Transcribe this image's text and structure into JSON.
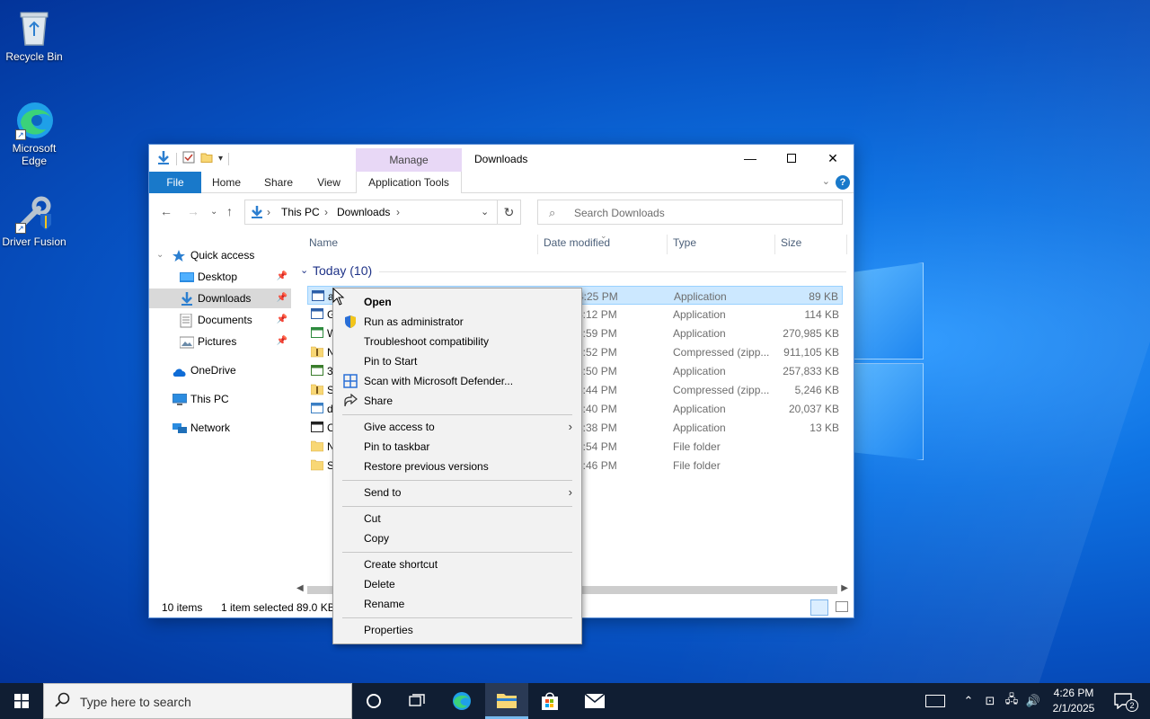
{
  "desktop": {
    "icons": [
      {
        "label": "Recycle Bin"
      },
      {
        "label": "Microsoft Edge"
      },
      {
        "label": "Driver Fusion"
      }
    ]
  },
  "explorer": {
    "title": "Downloads",
    "manage_tab": "Manage",
    "ribbon_tabs": {
      "file": "File",
      "home": "Home",
      "share": "Share",
      "view": "View",
      "app_tools": "Application Tools"
    },
    "address": {
      "this_pc": "This PC",
      "downloads": "Downloads"
    },
    "search_placeholder": "Search Downloads",
    "nav": {
      "quick_access": "Quick access",
      "desktop": "Desktop",
      "downloads": "Downloads",
      "documents": "Documents",
      "pictures": "Pictures",
      "onedrive": "OneDrive",
      "this_pc": "This PC",
      "network": "Network"
    },
    "columns": {
      "name": "Name",
      "date": "Date modified",
      "type": "Type",
      "size": "Size"
    },
    "group": "Today (10)",
    "files": [
      {
        "name": "a",
        "date": "4:25 PM",
        "type": "Application",
        "size": "89 KB"
      },
      {
        "name": "G",
        "date": "4:12 PM",
        "type": "Application",
        "size": "114 KB"
      },
      {
        "name": "W",
        "date": "3:59 PM",
        "type": "Application",
        "size": "270,985 KB"
      },
      {
        "name": "N",
        "date": "3:52 PM",
        "type": "Compressed (zipp...",
        "size": "911,105 KB"
      },
      {
        "name": "3",
        "date": "3:50 PM",
        "type": "Application",
        "size": "257,833 KB"
      },
      {
        "name": "S",
        "date": "3:44 PM",
        "type": "Compressed (zipp...",
        "size": "5,246 KB"
      },
      {
        "name": "d",
        "date": "3:40 PM",
        "type": "Application",
        "size": "20,037 KB"
      },
      {
        "name": "C",
        "date": "3:38 PM",
        "type": "Application",
        "size": "13 KB"
      },
      {
        "name": "N",
        "date": "3:54 PM",
        "type": "File folder",
        "size": ""
      },
      {
        "name": "S",
        "date": "3:46 PM",
        "type": "File folder",
        "size": ""
      }
    ],
    "status": {
      "items": "10 items",
      "selected": "1 item selected",
      "size": "89.0 KB"
    }
  },
  "context_menu": {
    "open": "Open",
    "run_admin": "Run as administrator",
    "troubleshoot": "Troubleshoot compatibility",
    "pin_start": "Pin to Start",
    "defender": "Scan with Microsoft Defender...",
    "share": "Share",
    "give_access": "Give access to",
    "pin_taskbar": "Pin to taskbar",
    "restore": "Restore previous versions",
    "send_to": "Send to",
    "cut": "Cut",
    "copy": "Copy",
    "create_shortcut": "Create shortcut",
    "delete": "Delete",
    "rename": "Rename",
    "properties": "Properties"
  },
  "taskbar": {
    "search_placeholder": "Type here to search",
    "time": "4:26 PM",
    "date": "2/1/2025",
    "notification_count": "2"
  },
  "colors": {
    "accent": "#1979ca",
    "selection": "#cce8ff",
    "taskbar": "#101e33",
    "manage_tab": "#e8d8f6"
  }
}
